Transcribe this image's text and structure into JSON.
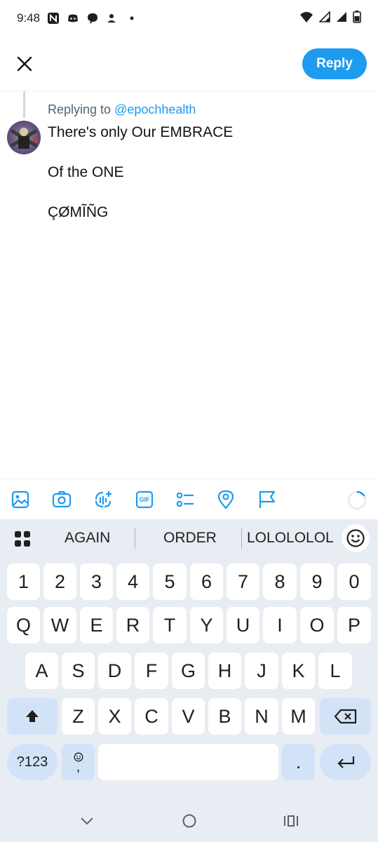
{
  "status_bar": {
    "time": "9:48",
    "left_icons": [
      "news-icon",
      "discord-icon",
      "chat-bubble-icon",
      "person-upload-icon",
      "dot-icon"
    ],
    "right_icons": [
      "wifi-icon",
      "signal-icon",
      "signal-icon",
      "battery-icon"
    ]
  },
  "header": {
    "close_icon": "close-icon",
    "reply_label": "Reply"
  },
  "compose": {
    "replying_prefix": "Replying to",
    "replying_handle": "@epochhealth",
    "lines": [
      "There's only Our EMBRACE",
      "Of the ONE",
      "ÇØMĨÑG"
    ]
  },
  "toolbar": {
    "tools": [
      "image-icon",
      "camera-icon",
      "voice-spaces-icon",
      "gif-icon",
      "poll-icon",
      "location-icon",
      "flag-icon"
    ],
    "gif_label": "GIF"
  },
  "keyboard": {
    "suggestions": [
      "AGAIN",
      "ORDER",
      "LOLOLOLOL"
    ],
    "row_numbers": [
      "1",
      "2",
      "3",
      "4",
      "5",
      "6",
      "7",
      "8",
      "9",
      "0"
    ],
    "row_1": [
      "Q",
      "W",
      "E",
      "R",
      "T",
      "Y",
      "U",
      "I",
      "O",
      "P"
    ],
    "row_2": [
      "A",
      "S",
      "D",
      "F",
      "G",
      "H",
      "J",
      "K",
      "L"
    ],
    "row_3": [
      "Z",
      "X",
      "C",
      "V",
      "B",
      "N",
      "M"
    ],
    "sym_label": "?123",
    "comma_label": ",",
    "period_label": "."
  },
  "colors": {
    "accent": "#1d9bf0",
    "keyboard_bg": "#e8ecf3",
    "modifier_key": "#d3e3f7"
  }
}
